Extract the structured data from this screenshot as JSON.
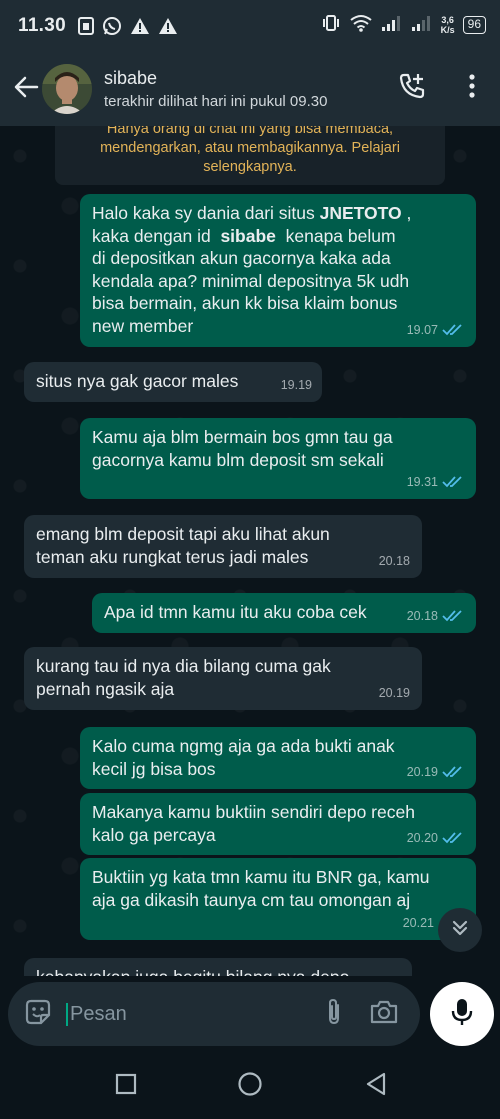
{
  "status_bar": {
    "time": "11.30",
    "network_speed_value": "3,6",
    "network_speed_unit": "K/s",
    "battery": "96",
    "icons": [
      "sim-card-icon",
      "whatsapp-icon",
      "warning-icon",
      "warning-icon",
      "vibrate-icon",
      "wifi-icon",
      "signal-icon",
      "signal-icon",
      "battery-icon"
    ]
  },
  "header": {
    "contact_name": "sibabe",
    "last_seen": "terakhir dilihat hari ini pukul 09.30",
    "icons": [
      "back-arrow-icon",
      "add-call-icon",
      "more-vert-icon"
    ]
  },
  "system_notice": "Hanya orang di chat ini yang bisa membaca, mendengarkan, atau membagikannya. Pelajari selengkapnya.",
  "messages": [
    {
      "direction": "out",
      "time": "19.07",
      "read": true,
      "parts": [
        "Halo kaka sy dania dari situs ",
        "JNETOTO",
        " ,\nkaka dengan id  ",
        "sibabe",
        "  kenapa belum\ndi depositkan akun gacornya kaka ada\nkendala apa? minimal depositnya 5k udh\nbisa bermain, akun kk bisa klaim bonus\nnew member"
      ]
    },
    {
      "direction": "in",
      "time": "19.19",
      "text": "situs nya gak gacor males"
    },
    {
      "direction": "out",
      "time": "19.31",
      "read": true,
      "text": "Kamu aja blm bermain bos gmn tau ga\ngacornya kamu blm deposit sm sekali"
    },
    {
      "direction": "in",
      "time": "20.18",
      "text": "emang blm deposit tapi aku lihat akun\nteman aku rungkat terus jadi males"
    },
    {
      "direction": "out",
      "time": "20.18",
      "read": true,
      "text": "Apa id tmn kamu itu aku coba cek"
    },
    {
      "direction": "in",
      "time": "20.19",
      "text": "kurang tau id nya dia bilang cuma gak\npernah ngasik aja"
    },
    {
      "direction": "out",
      "time": "20.19",
      "read": true,
      "text": "Kalo cuma ngmg aja ga ada bukti anak\nkecil jg bisa bos"
    },
    {
      "direction": "out",
      "time": "20.20",
      "read": true,
      "text": "Makanya kamu buktiin sendiri depo receh\nkalo ga percaya"
    },
    {
      "direction": "out",
      "time": "20.21",
      "read": true,
      "text": "Buktiin yg kata tmn kamu itu BNR ga, kamu\naja ga dikasih taunya cm tau omongan aj"
    },
    {
      "direction": "in",
      "time": "",
      "text": "kebanyakan juga begitu bilang nya depo"
    }
  ],
  "composer": {
    "placeholder": "Pesan",
    "icons": [
      "sticker-icon",
      "attach-icon",
      "camera-icon",
      "mic-icon"
    ]
  },
  "colors": {
    "background": "#0b141a",
    "bar": "#1f2c34",
    "outgoing_bubble": "#005c4b",
    "incoming_bubble": "#1f2c34",
    "read_ticks": "#53bdeb",
    "system_text": "#e2b358"
  }
}
